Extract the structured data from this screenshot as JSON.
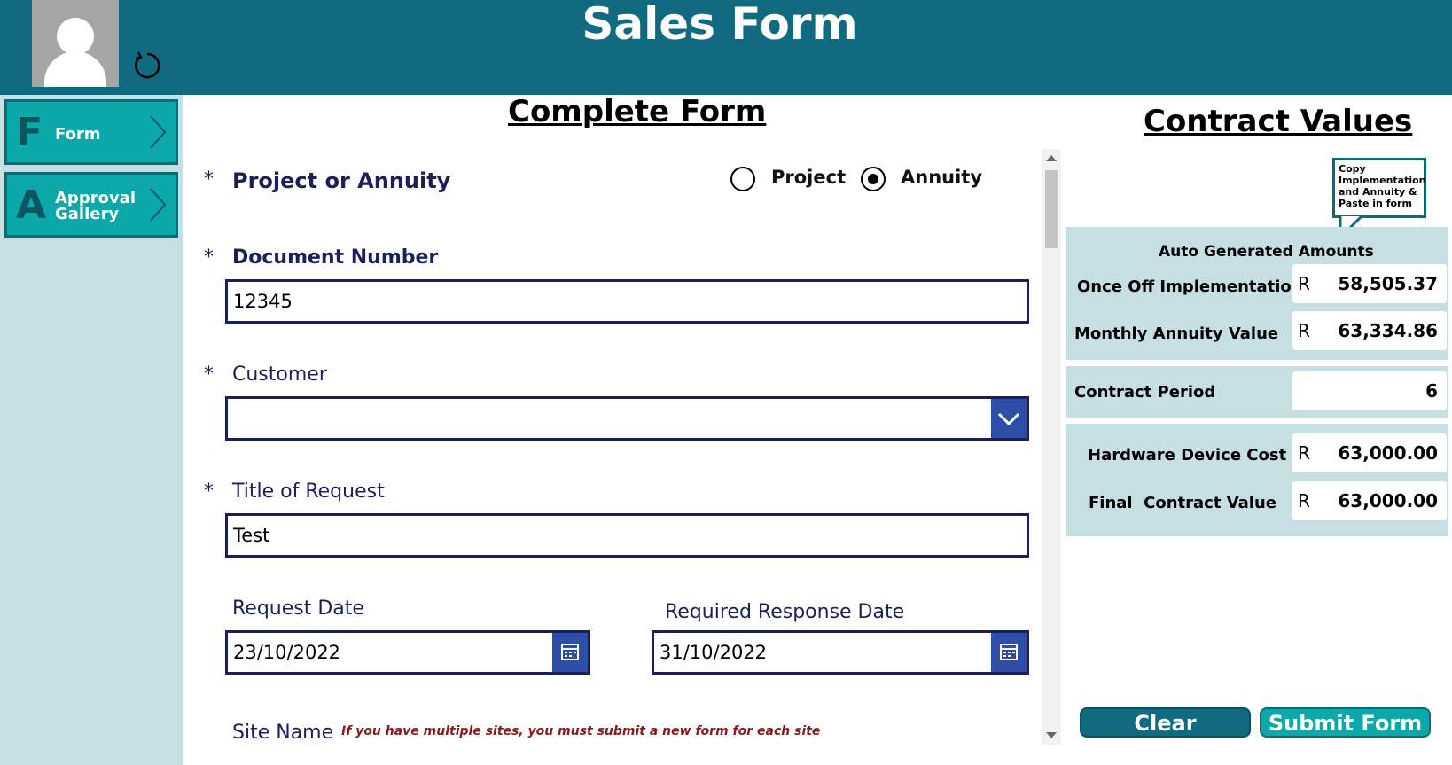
{
  "header": {
    "title": "Sales Form"
  },
  "sidebar": {
    "items": [
      {
        "letter": "F",
        "label": "Form"
      },
      {
        "letter": "A",
        "label": "Approval Gallery"
      }
    ]
  },
  "form": {
    "title": "Complete Form",
    "required_mark": "*",
    "project_or_annuity": {
      "label": "Project or Annuity",
      "options": [
        "Project",
        "Annuity"
      ],
      "selected": "Annuity"
    },
    "document_number": {
      "label": "Document Number",
      "value": "12345"
    },
    "customer": {
      "label": "Customer",
      "value": ""
    },
    "title_of_request": {
      "label": "Title of Request",
      "value": "Test"
    },
    "request_date": {
      "label": "Request Date",
      "value": "23/10/2022"
    },
    "required_response_date": {
      "label": "Required Response Date",
      "value": "31/10/2022"
    },
    "site_name": {
      "label": "Site Name",
      "note": "If you have multiple sites, you must submit a new form for each site"
    }
  },
  "contract": {
    "title": "Contract Values",
    "callout": "Copy Implementation and Annuity & Paste in form",
    "auto_heading": "Auto Generated Amounts",
    "currency": "R",
    "once_off": {
      "label": "Once Off Implementation",
      "value": "58,505.37"
    },
    "monthly_annuity": {
      "label": "Monthly Annuity Value",
      "value": "63,334.86"
    },
    "contract_period": {
      "label": "Contract Period",
      "value": "6"
    },
    "hardware_cost": {
      "label": "Hardware Device Cost",
      "value": "63,000.00"
    },
    "final_value": {
      "label": "Final  Contract Value",
      "value": "63,000.00"
    }
  },
  "actions": {
    "clear": "Clear",
    "submit": "Submit Form"
  },
  "colors": {
    "header": "#106a80",
    "nav": "#0aa8a8",
    "panel": "#c5dfe2",
    "input_border": "#1b1f5c",
    "accent_blue": "#2e4fa8"
  }
}
